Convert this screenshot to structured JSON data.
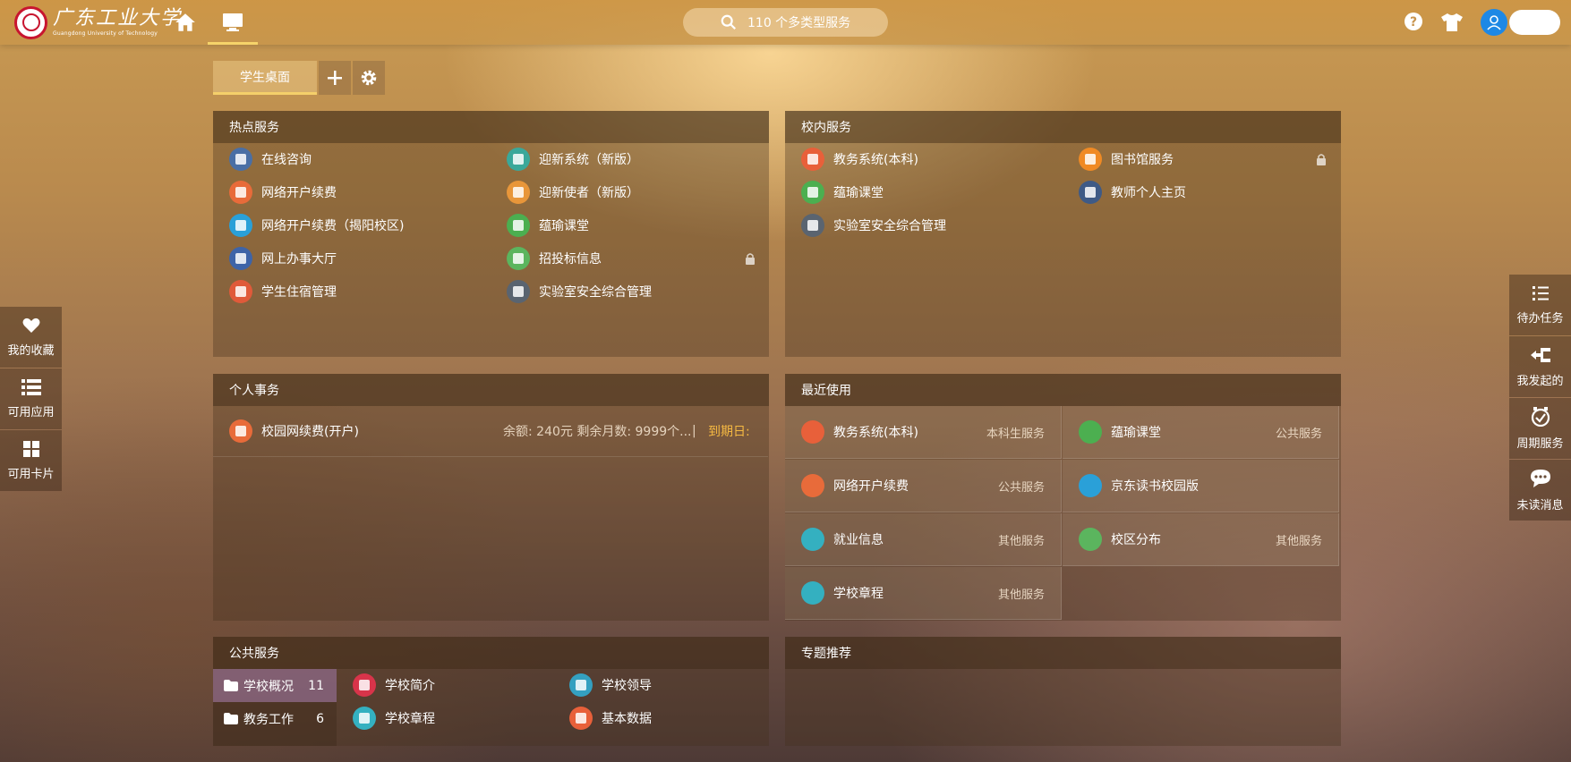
{
  "logo": {
    "cn": "广东工业大学",
    "en": "Guangdong University of Technology"
  },
  "search": {
    "placeholder": "110 个多类型服务"
  },
  "tabs": {
    "active": "学生桌面"
  },
  "hot": {
    "title": "热点服务",
    "items": [
      {
        "label": "在线咨询",
        "color": "#4a6fa5"
      },
      {
        "label": "迎新系统（新版）",
        "color": "#3aa89a"
      },
      {
        "label": "网络开户续费",
        "color": "#e86b3a"
      },
      {
        "label": "迎新使者（新版）",
        "color": "#e8963a"
      },
      {
        "label": "网络开户续费（揭阳校区)",
        "color": "#2aa0d8"
      },
      {
        "label": "蕴瑜课堂",
        "color": "#4caf50"
      },
      {
        "label": "网上办事大厅",
        "color": "#3e64a8"
      },
      {
        "label": "招投标信息",
        "color": "#5bb55e"
      },
      {
        "label": "学生住宿管理",
        "color": "#e05a3a"
      },
      {
        "label": "实验室安全综合管理",
        "color": "#5a6470"
      }
    ]
  },
  "campus": {
    "title": "校内服务",
    "items": [
      {
        "label": "教务系统(本科)",
        "color": "#e8603a"
      },
      {
        "label": "图书馆服务",
        "color": "#f08a24"
      },
      {
        "label": "蕴瑜课堂",
        "color": "#4caf50"
      },
      {
        "label": "教师个人主页",
        "color": "#3e5a86"
      },
      {
        "label": "实验室安全综合管理",
        "color": "#5a6470"
      }
    ]
  },
  "personal": {
    "title": "个人事务",
    "item": {
      "label": "校园网续费(开户)",
      "info": "余额: 240元 剩余月数: 9999个...",
      "sep": "|",
      "due": "到期日:",
      "color": "#e86b3a"
    }
  },
  "recent": {
    "title": "最近使用",
    "items": [
      {
        "label": "教务系统(本科)",
        "cat": "本科生服务",
        "color": "#e8603a"
      },
      {
        "label": "蕴瑜课堂",
        "cat": "公共服务",
        "color": "#4caf50"
      },
      {
        "label": "网络开户续费",
        "cat": "公共服务",
        "color": "#e86b3a"
      },
      {
        "label": "京东读书校园版",
        "cat": "",
        "color": "#2aa0d8"
      },
      {
        "label": "就业信息",
        "cat": "其他服务",
        "color": "#34b0c0"
      },
      {
        "label": "校区分布",
        "cat": "其他服务",
        "color": "#5bb55e"
      },
      {
        "label": "学校章程",
        "cat": "其他服务",
        "color": "#34b0c0"
      }
    ]
  },
  "public": {
    "title": "公共服务",
    "categories": [
      {
        "label": "学校概况",
        "count": "11"
      },
      {
        "label": "教务工作",
        "count": "6"
      }
    ],
    "items": [
      {
        "label": "学校简介",
        "color": "#d8344a"
      },
      {
        "label": "学校领导",
        "color": "#34a0c0"
      },
      {
        "label": "学校章程",
        "color": "#34b0c0"
      },
      {
        "label": "基本数据",
        "color": "#e8603a"
      }
    ]
  },
  "topic": {
    "title": "专题推荐"
  },
  "left_sidebar": [
    {
      "label": "我的收藏",
      "icon": "heart-icon"
    },
    {
      "label": "可用应用",
      "icon": "list-icon"
    },
    {
      "label": "可用卡片",
      "icon": "grid-icon"
    }
  ],
  "right_sidebar": [
    {
      "label": "待办任务",
      "icon": "task-list-icon"
    },
    {
      "label": "我发起的",
      "icon": "flow-icon"
    },
    {
      "label": "周期服务",
      "icon": "cycle-check-icon"
    },
    {
      "label": "未读消息",
      "icon": "message-icon"
    }
  ]
}
